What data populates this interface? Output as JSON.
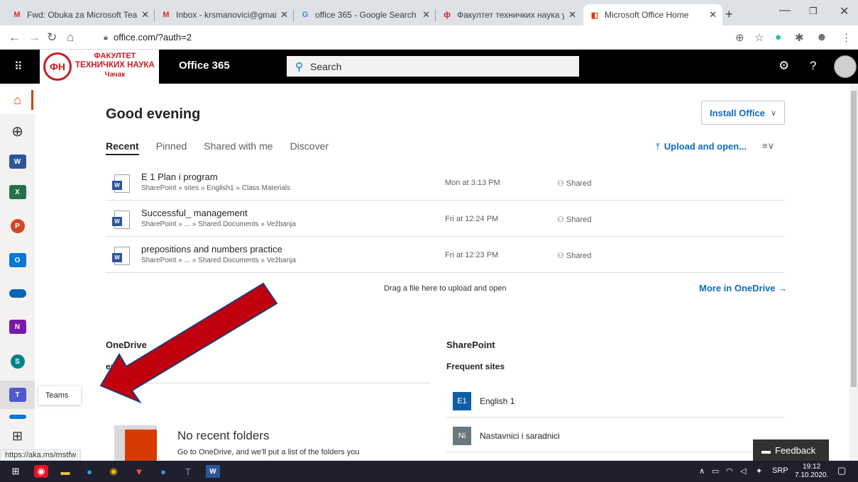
{
  "browser": {
    "tabs": [
      {
        "title": "Fwd: Obuka za Microsoft Teams",
        "icon": "gmail-icon"
      },
      {
        "title": "Inbox - krsmanovici@gmail.com",
        "icon": "gmail-icon"
      },
      {
        "title": "office 365 - Google Search",
        "icon": "google-icon"
      },
      {
        "title": "Факултет техничких наука у Ч",
        "icon": "ftn-icon"
      },
      {
        "title": "Microsoft Office Home",
        "icon": "office-icon"
      }
    ],
    "url": "office.com/?auth=2",
    "status_url": "https://aka.ms/mstfw"
  },
  "header": {
    "org_line1": "ФАКУЛТЕТ",
    "org_line2": "ТЕХНИЧКИХ НАУКА",
    "org_line3": "Чачак",
    "seal": "ФН",
    "app_name": "Office 365",
    "search_placeholder": "Search"
  },
  "rail": {
    "tooltip": "Teams"
  },
  "main": {
    "greeting": "Good evening",
    "install_label": "Install Office",
    "tabs": [
      "Recent",
      "Pinned",
      "Shared with me",
      "Discover"
    ],
    "upload_label": "Upload and open...",
    "files": [
      {
        "name": "E 1 Plan i program",
        "path": "SharePoint » sites » English1 » Class Materials",
        "date": "Mon at 3:13 PM",
        "status": "Shared"
      },
      {
        "name": "Successful_ management",
        "path": "SharePoint » ... » Shared Documents » Vežbanja",
        "date": "Fri at 12:24 PM",
        "status": "Shared"
      },
      {
        "name": "prepositions and numbers practice",
        "path": "SharePoint » ... » Shared Documents » Vežbanja",
        "date": "Fri at 12:23 PM",
        "status": "Shared"
      }
    ],
    "drag_text": "Drag a file here to upload and open",
    "more_onedrive": "More in OneDrive",
    "onedrive_head": "OneDrive",
    "onedrive_sub": "ers",
    "sharepoint_head": "SharePoint",
    "sharepoint_sub": "Frequent sites",
    "sites": [
      {
        "abbr": "E1",
        "name": "English 1",
        "color": "#0f5fa6"
      },
      {
        "abbr": "Ni",
        "name": "Nastavnici i saradnici",
        "color": "#69797e"
      }
    ],
    "no_folders_title": "No recent folders",
    "no_folders_text": "Go to OneDrive, and we'll put a list of the folders you",
    "feedback": "Feedback"
  },
  "taskbar": {
    "lang": "SRP",
    "time": "19:12",
    "date": "7.10.2020."
  },
  "colors": {
    "accent": "#0f6cbd",
    "office_orange": "#d83b01",
    "arrow_red": "#c0000d"
  }
}
